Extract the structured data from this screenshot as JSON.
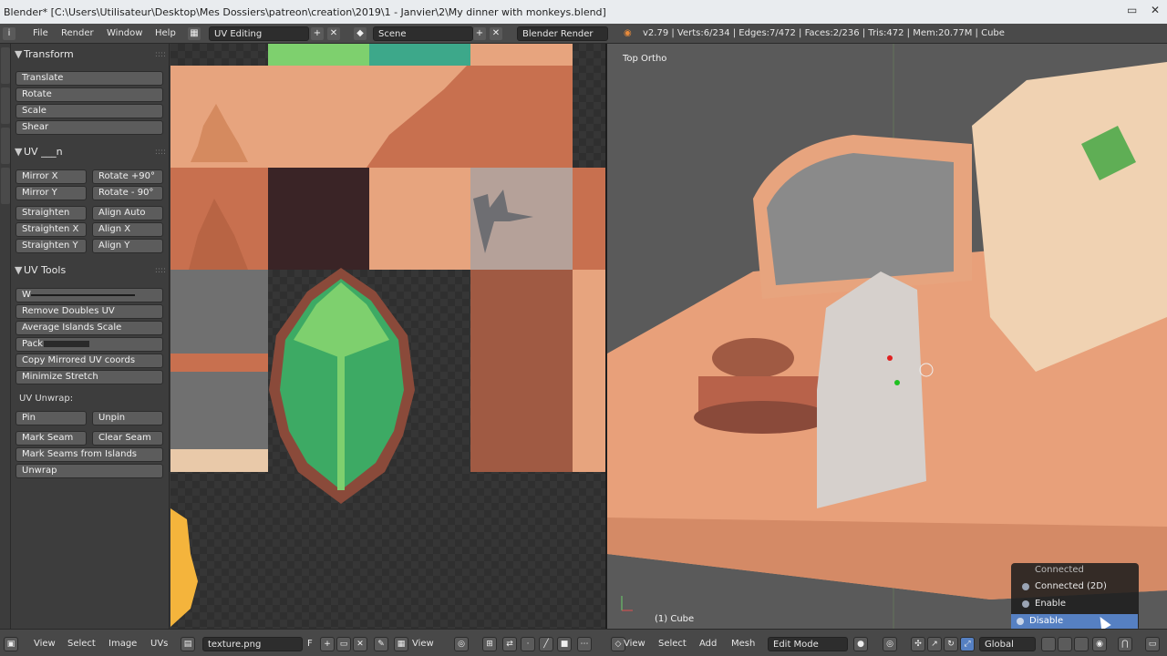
{
  "window": {
    "title": "Blender* [C:\\Users\\Utilisateur\\Desktop\\Mes Dossiers\\patreon\\creation\\2019\\1 - Janvier\\2\\My dinner with monkeys.blend]"
  },
  "infobar": {
    "menus": [
      "File",
      "Render",
      "Window",
      "Help"
    ],
    "layout": "UV Editing",
    "scene": "Scene",
    "engine": "Blender Render",
    "stats": "v2.79 | Verts:6/234 | Edges:7/472 | Faces:2/236 | Tris:472 | Mem:20.77M | Cube"
  },
  "toolshelf": {
    "transform_header": "Transform",
    "transform_buttons": [
      "Translate",
      "Rotate",
      "Scale",
      "Shear"
    ],
    "uv_header": "UV ___n",
    "mirror_x": "Mirror X",
    "rotate_pos90": "Rotate +90°",
    "mirror_y": "Mirror Y",
    "rotate_neg90": "Rotate - 90°",
    "straighten": "Straighten",
    "align_auto": "Align Auto",
    "straighten_x": "Straighten X",
    "align_x": "Align X",
    "straighten_y": "Straighten Y",
    "align_y": "Align Y",
    "uv_tools_header": "UV Tools",
    "weld_label": "W",
    "remove_doubles": "Remove Doubles UV",
    "average_islands": "Average Islands Scale",
    "pack": "Pack",
    "copy_mirrored": "Copy Mirrored UV coords",
    "minimize_stretch": "Minimize Stretch",
    "uv_unwrap_label": "UV Unwrap:",
    "pin": "Pin",
    "unpin": "Unpin",
    "mark_seam": "Mark Seam",
    "clear_seam": "Clear Seam",
    "mark_seams_islands": "Mark Seams from Islands",
    "unwrap": "Unwrap"
  },
  "viewport": {
    "view_name": "Top Ortho",
    "object_label": "(1) Cube"
  },
  "popup": {
    "items": [
      "Connected",
      "Connected (2D)",
      "Enable",
      "Disable"
    ],
    "selected": "Disable",
    "selected_color": "#5680c2"
  },
  "uv_bottom": {
    "menus": [
      "View",
      "Select",
      "Image",
      "UVs"
    ],
    "image_name": "texture.png",
    "fake_user": "F",
    "view_menu": "View"
  },
  "viewport_bottom": {
    "menus": [
      "View",
      "Select",
      "Add",
      "Mesh"
    ],
    "mode": "Edit Mode",
    "orientation": "Global"
  },
  "colors": {
    "leaf_green": "#3daa64",
    "leaf_light": "#7ed06e",
    "leaf_border": "#8a4a3a",
    "terracotta": "#c8704f",
    "peach": "#e7a47e",
    "selection_blue": "#5680c2"
  }
}
